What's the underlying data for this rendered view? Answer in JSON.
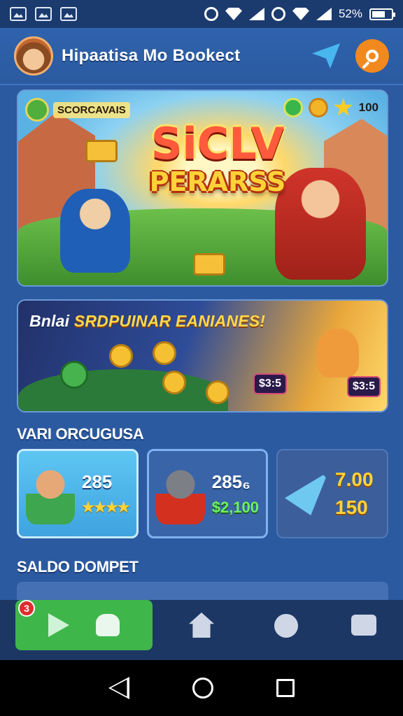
{
  "status_bar": {
    "battery_text": "52%"
  },
  "header": {
    "title": "Hipaatisa Mo Bookect"
  },
  "hero": {
    "badge_text": "SCORCAVAIS",
    "stat_value": "100",
    "title_line1": "SiCLV",
    "title_line2": "PERARSS"
  },
  "promo": {
    "title_white": "Bnlai",
    "title_gold": "SRDPUINAR EANIANES!",
    "price1": "$3:5",
    "price2": "$3:5"
  },
  "section1": {
    "title": "VARI ORCUGUSA"
  },
  "cards": [
    {
      "value": "285",
      "sub": "★★★★",
      "sub_kind": "stars"
    },
    {
      "value": "285₆",
      "sub": "$2,100",
      "sub_kind": "money"
    },
    {
      "value": "7.00",
      "sub": "150",
      "sub_kind": "gold"
    }
  ],
  "section2": {
    "title": "SALDO DOMPET"
  },
  "bottom_nav": {
    "badge_count": "3",
    "items": [
      "play",
      "chef",
      "home",
      "timer",
      "camera"
    ]
  },
  "icons": {
    "header_left": "avatar",
    "header_plane": "paper-plane-icon",
    "header_search": "search-icon"
  },
  "colors": {
    "background": "#2b5aa0",
    "accent_orange": "#f2891e",
    "nav_active": "#3fb64a",
    "gold": "#ffd338"
  }
}
